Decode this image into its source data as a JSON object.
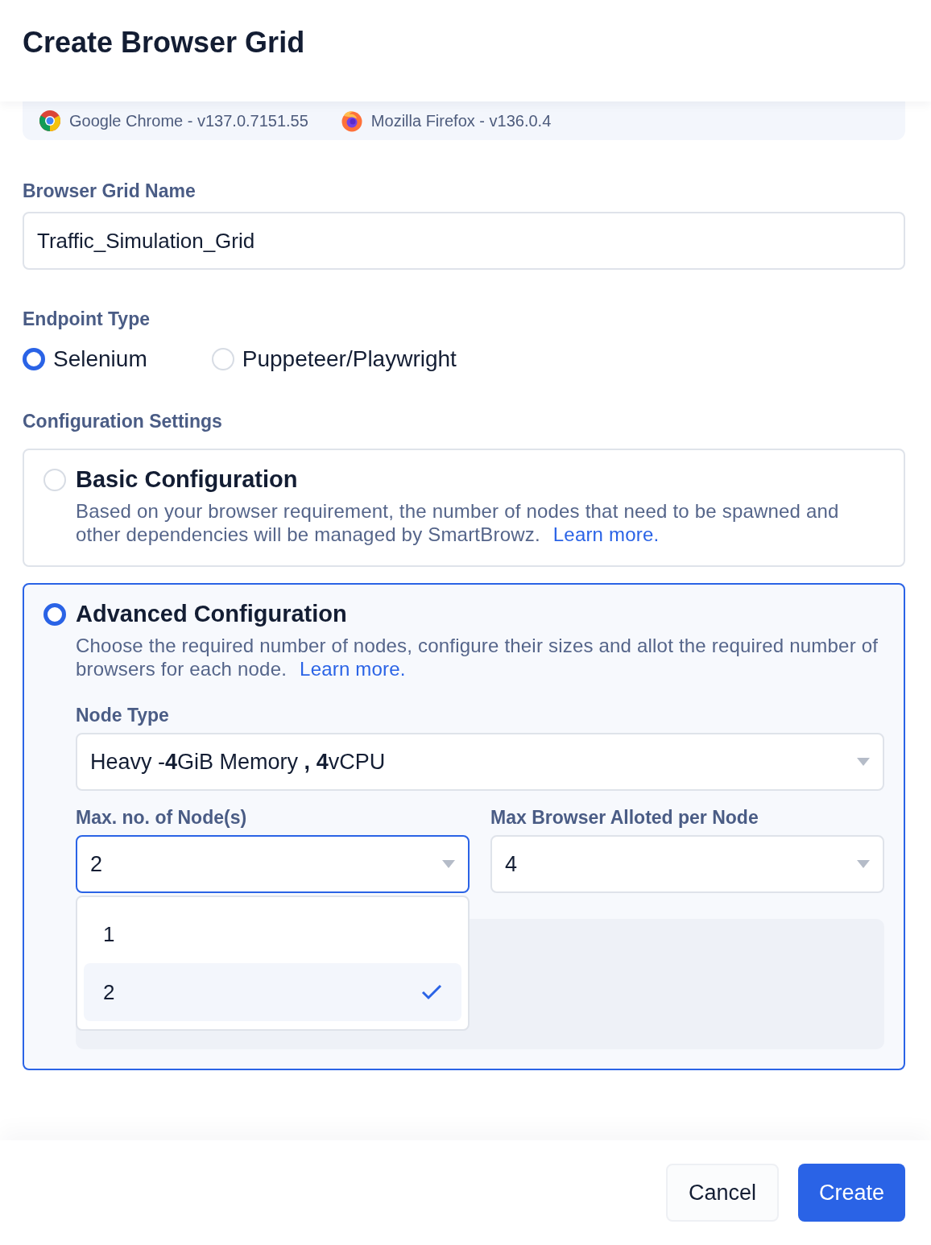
{
  "window": {
    "title": "Create Browser Grid"
  },
  "browsers": [
    {
      "kind": "chrome",
      "label": "Google Chrome - v137.0.7151.55"
    },
    {
      "kind": "firefox",
      "label": "Mozilla Firefox - v136.0.4"
    }
  ],
  "grid_name": {
    "label": "Browser Grid Name",
    "value": "Traffic_Simulation_Grid"
  },
  "endpoint_type": {
    "label": "Endpoint Type",
    "options": [
      {
        "label": "Selenium",
        "selected": true
      },
      {
        "label": "Puppeteer/Playwright",
        "selected": false
      }
    ]
  },
  "configuration": {
    "label": "Configuration Settings",
    "options": [
      {
        "title": "Basic Configuration",
        "description": "Based on your browser requirement, the number of nodes that need to be spawned and other dependencies will be managed by SmartBrowz.",
        "link": "Learn more.",
        "selected": false
      },
      {
        "title": "Advanced Configuration",
        "description": "Choose the required number of nodes, configure their sizes and allot the required number of browsers for each node.",
        "link": "Learn more.",
        "selected": true
      }
    ]
  },
  "node_type": {
    "label": "Node Type",
    "value": "Heavy -**4**GiB Memory **,** **4**vCPU"
  },
  "max_nodes": {
    "label": "Max. no. of Node(s)",
    "value": "2",
    "open": true,
    "options": [
      {
        "label": "1",
        "selected": false
      },
      {
        "label": "2",
        "selected": true
      }
    ]
  },
  "max_browsers": {
    "label": "Max Browser Alloted per Node",
    "value": "4",
    "open": false
  },
  "buttons": [
    {
      "label": "Cancel",
      "kind": "secondary"
    },
    {
      "label": "Create",
      "kind": "primary"
    }
  ]
}
